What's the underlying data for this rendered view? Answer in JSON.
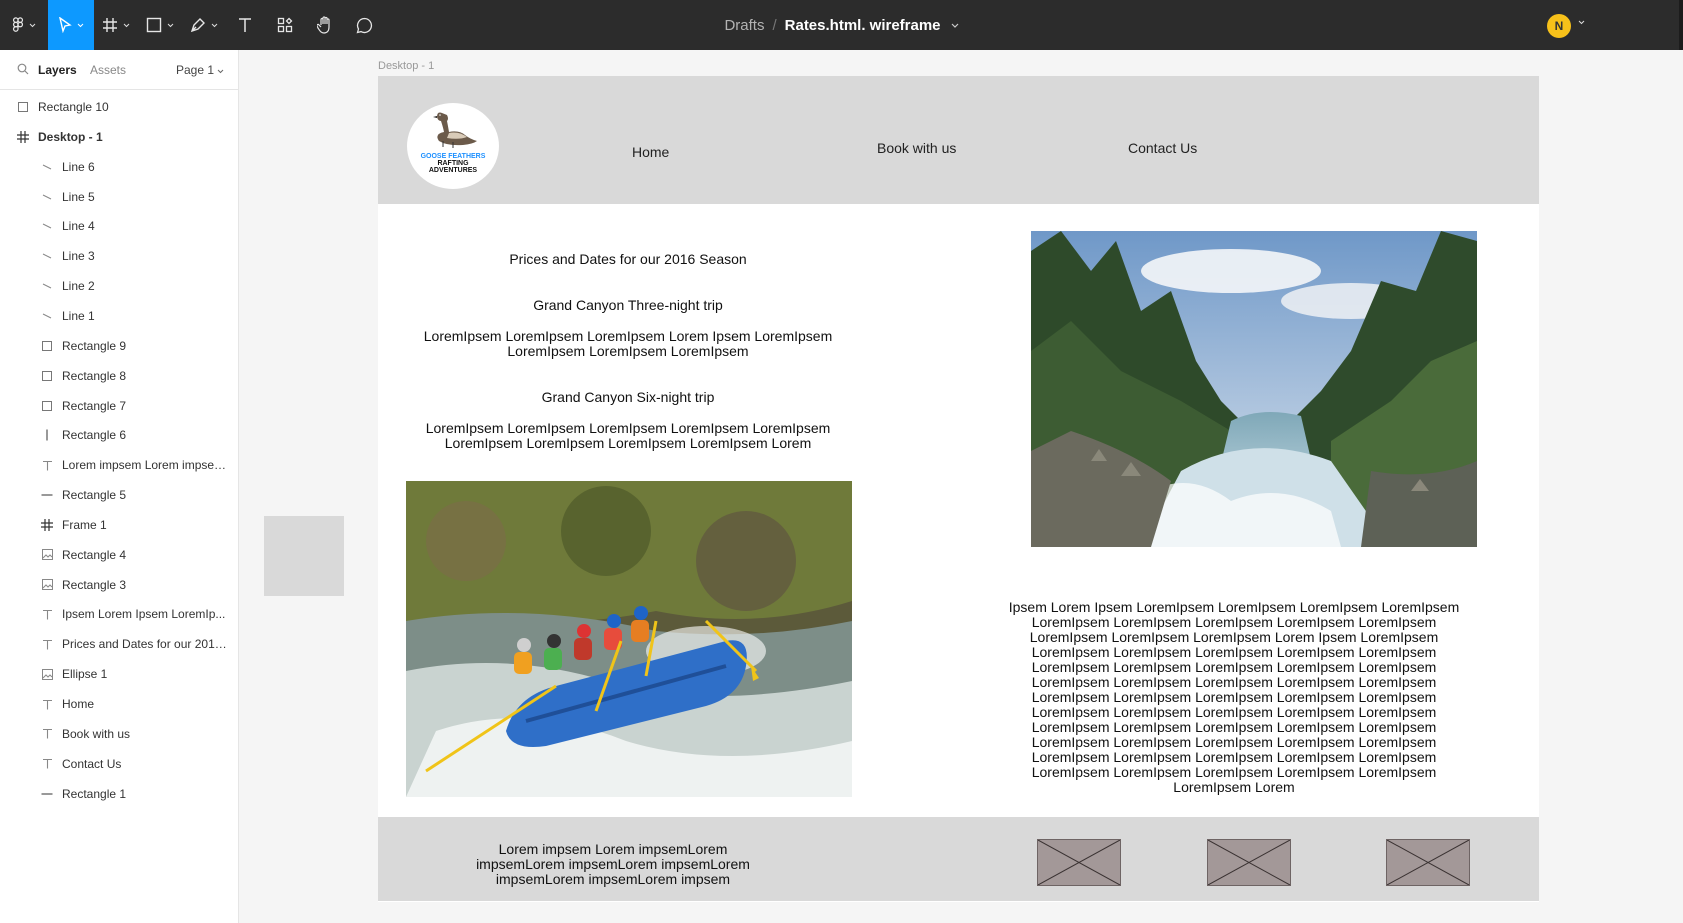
{
  "toolbar": {
    "breadcrumb": {
      "folder": "Drafts",
      "separator": "/",
      "file": "Rates.html. wireframe"
    },
    "avatar_initial": "N",
    "tools": [
      "figma-menu",
      "move-tool",
      "frame-tool",
      "shape-tool",
      "pen-tool",
      "text-tool",
      "resources-tool",
      "hand-tool",
      "comment-tool"
    ]
  },
  "left_panel": {
    "tabs": {
      "layers": "Layers",
      "assets": "Assets",
      "page": "Page 1"
    },
    "layers": [
      {
        "label": "Rectangle 10",
        "icon": "rectangle-icon",
        "level": "top"
      },
      {
        "label": "Desktop - 1",
        "icon": "frame-icon",
        "level": "top"
      },
      {
        "label": "Line 6",
        "icon": "line-icon",
        "level": "child"
      },
      {
        "label": "Line 5",
        "icon": "line-icon",
        "level": "child"
      },
      {
        "label": "Line 4",
        "icon": "line-icon",
        "level": "child"
      },
      {
        "label": "Line 3",
        "icon": "line-icon",
        "level": "child"
      },
      {
        "label": "Line 2",
        "icon": "line-icon",
        "level": "child"
      },
      {
        "label": "Line 1",
        "icon": "line-icon",
        "level": "child"
      },
      {
        "label": "Rectangle 9",
        "icon": "rectangle-icon",
        "level": "child"
      },
      {
        "label": "Rectangle 8",
        "icon": "rectangle-icon",
        "level": "child"
      },
      {
        "label": "Rectangle 7",
        "icon": "rectangle-icon",
        "level": "child"
      },
      {
        "label": "Rectangle 6",
        "icon": "vertical-rectangle-icon",
        "level": "child"
      },
      {
        "label": "Lorem impsem Lorem impsem...",
        "icon": "text-icon",
        "level": "child"
      },
      {
        "label": "Rectangle 5",
        "icon": "horizontal-rectangle-icon",
        "level": "child"
      },
      {
        "label": "Frame 1",
        "icon": "frame-icon",
        "level": "child"
      },
      {
        "label": "Rectangle 4",
        "icon": "image-icon",
        "level": "child"
      },
      {
        "label": "Rectangle 3",
        "icon": "image-icon",
        "level": "child"
      },
      {
        "label": "Ipsem Lorem Ipsem LoremIp...",
        "icon": "text-icon",
        "level": "child"
      },
      {
        "label": "Prices and Dates for our 2016 ...",
        "icon": "text-icon",
        "level": "child"
      },
      {
        "label": "Ellipse 1",
        "icon": "image-icon",
        "level": "child"
      },
      {
        "label": "Home",
        "icon": "text-icon",
        "level": "child"
      },
      {
        "label": "Book with us",
        "icon": "text-icon",
        "level": "child"
      },
      {
        "label": "Contact Us",
        "icon": "text-icon",
        "level": "child"
      },
      {
        "label": "Rectangle 1",
        "icon": "horizontal-rectangle-icon",
        "level": "child"
      }
    ]
  },
  "canvas": {
    "frame_label": "Desktop - 1",
    "wireframe": {
      "logo": {
        "line1": "GOOSE FEATHERS",
        "line2": "RAFTING",
        "line3": "ADVENTURES"
      },
      "nav": {
        "home": "Home",
        "book": "Book with us",
        "contact": "Contact Us"
      },
      "heading": "Prices and Dates for our 2016 Season",
      "trip1_title": "Grand Canyon Three-night trip",
      "trip1_body_1": "LoremIpsem LoremIpsem LoremIpsem Lorem Ipsem LoremIpsem",
      "trip1_body_2": "LoremIpsem LoremIpsem LoremIpsem",
      "trip2_title": "Grand Canyon Six-night trip",
      "trip2_body_1": "LoremIpsem LoremIpsem LoremIpsem LoremIpsem LoremIpsem",
      "trip2_body_2": "LoremIpsem LoremIpsem LoremIpsem LoremIpsem Lorem",
      "side_text": [
        "Ipsem Lorem Ipsem LoremIpsem LoremIpsem LoremIpsem LoremIpsem",
        "LoremIpsem LoremIpsem LoremIpsem LoremIpsem LoremIpsem",
        "LoremIpsem LoremIpsem LoremIpsem Lorem Ipsem LoremIpsem",
        "LoremIpsem LoremIpsem LoremIpsem LoremIpsem LoremIpsem",
        "LoremIpsem LoremIpsem LoremIpsem LoremIpsem LoremIpsem",
        "LoremIpsem LoremIpsem LoremIpsem LoremIpsem LoremIpsem",
        "LoremIpsem LoremIpsem LoremIpsem LoremIpsem LoremIpsem",
        "LoremIpsem LoremIpsem LoremIpsem LoremIpsem LoremIpsem",
        "LoremIpsem LoremIpsem LoremIpsem LoremIpsem LoremIpsem",
        "LoremIpsem LoremIpsem LoremIpsem LoremIpsem LoremIpsem",
        "LoremIpsem LoremIpsem LoremIpsem LoremIpsem LoremIpsem",
        "LoremIpsem LoremIpsem LoremIpsem LoremIpsem LoremIpsem",
        "LoremIpsem Lorem"
      ],
      "footer_text": [
        "Lorem impsem Lorem impsemLorem",
        "impsemLorem impsemLorem impsemLorem",
        "impsemLorem impsemLorem impsem"
      ]
    }
  },
  "colors": {
    "toolbar_bg": "#2c2c2c",
    "accent": "#0d99ff",
    "avatar": "#f7c11a",
    "wireframe_gray": "#d9d9d9",
    "placeholder": "#a39898"
  }
}
